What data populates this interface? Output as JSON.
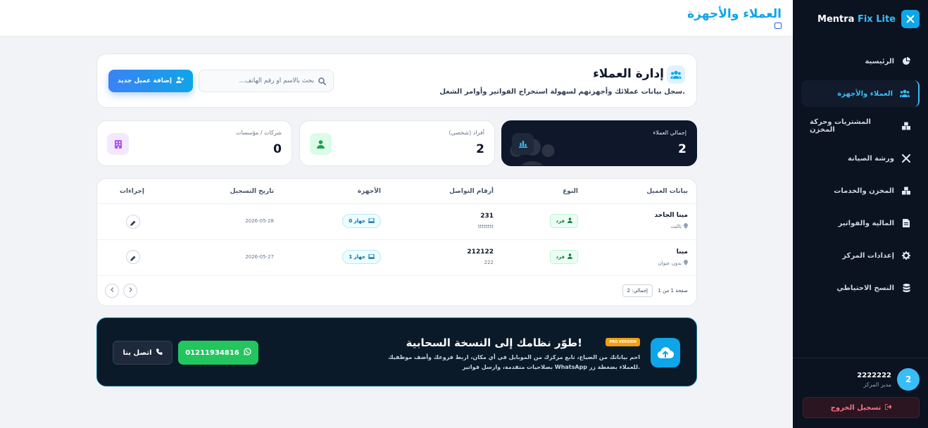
{
  "app": {
    "brand_primary": "Mentra",
    "brand_accent": "Fix Lite"
  },
  "header": {
    "page_title": "العملاء والأجهزة"
  },
  "sidebar": {
    "items": [
      {
        "label": "الرئيسية",
        "icon": "pie-chart-icon"
      },
      {
        "label": "العملاء والأجهزة",
        "icon": "users-icon",
        "active": true
      },
      {
        "label": "المشتريات وحركة المخزن",
        "icon": "boxes-icon"
      },
      {
        "label": "ورشة الصيانة",
        "icon": "tools-icon"
      },
      {
        "label": "المخزن والخدمات",
        "icon": "boxes-icon"
      },
      {
        "label": "المالية والفواتير",
        "icon": "invoice-icon"
      },
      {
        "label": "إعدادات المركز",
        "icon": "gear-icon"
      },
      {
        "label": "النسخ الاحتياطي",
        "icon": "database-icon"
      }
    ]
  },
  "user": {
    "avatar": "2",
    "name": "2222222",
    "role": "مدير المركز",
    "logout_label": "تسجيل الخروج"
  },
  "customers": {
    "title": "إدارة العملاء",
    "subtitle": "سجل بيانات عملائك وأجهزتهم لسهولة استخراج الفواتير وأوامر الشغل.",
    "search_placeholder": "بحث بالاسم أو رقم الهاتف...",
    "add_label": "إضافة عميل جديد"
  },
  "stats": [
    {
      "label": "إجمالي العملاء",
      "value": "2"
    },
    {
      "label": "أفراد (شخصي)",
      "value": "2"
    },
    {
      "label": "شركات / مؤسسات",
      "value": "0"
    }
  ],
  "table": {
    "headers": {
      "client": "بيانات العميل",
      "type": "النوع",
      "phones": "أرقام التواصل",
      "devices": "الأجهزة",
      "date": "تاريخ التسجيل",
      "actions": "إجراءات"
    },
    "rows": [
      {
        "name": "مينا الجاحد",
        "address": "ثالثث",
        "type": "فرد",
        "phone": "231",
        "phone2": "tttttttt",
        "devices": "0 جهاز",
        "date": "2026-05-28"
      },
      {
        "name": "مينا",
        "address": "بدون عنوان",
        "type": "فرد",
        "phone": "212122",
        "phone2": "222",
        "devices": "1 جهاز",
        "date": "2026-05-27"
      }
    ],
    "page_info": "صفحة 1 من 1",
    "total": "إجمالي: 2"
  },
  "promo": {
    "badge": "PRO VERSION",
    "title": "طوّر نظامك إلى النسخة السحابية!",
    "text": "احم بياناتك من الضياع، تابع مركزك من الموبايل في أي مكان، اربط فروعك وأضف موظفيك بصلاحيات متقدمة، وارسل فواتير WhatsApp للعملاء بضغطة زر.",
    "whatsapp_label": "01211934816",
    "call_label": "اتصل بنا"
  },
  "colors": {
    "accent": "#0ea5e9",
    "sidebar_bg": "#0b1220",
    "success": "#22c55e"
  }
}
